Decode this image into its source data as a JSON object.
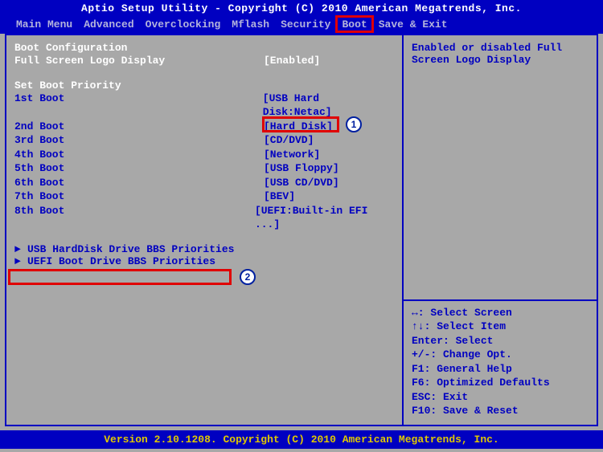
{
  "header": "Aptio Setup Utility - Copyright (C) 2010 American Megatrends, Inc.",
  "footer": "Version 2.10.1208. Copyright (C) 2010 American Megatrends, Inc.",
  "menu": {
    "items": [
      "Main Menu",
      "Advanced",
      "Overclocking",
      "Mflash",
      "Security",
      "Boot",
      "Save & Exit"
    ],
    "active_index": 5
  },
  "left": {
    "section1_title": "Boot Configuration",
    "logo_label": "Full Screen Logo Display",
    "logo_value": "[Enabled]",
    "section2_title": "Set Boot Priority",
    "boots": [
      {
        "label": "1st Boot",
        "value": "[USB Hard Disk:Netac]"
      },
      {
        "label": "2nd Boot",
        "value": "[Hard Disk]"
      },
      {
        "label": "3rd Boot",
        "value": "[CD/DVD]"
      },
      {
        "label": "4th Boot",
        "value": "[Network]"
      },
      {
        "label": "5th Boot",
        "value": "[USB Floppy]"
      },
      {
        "label": "6th Boot",
        "value": "[USB CD/DVD]"
      },
      {
        "label": "7th Boot",
        "value": "[BEV]"
      },
      {
        "label": "8th Boot",
        "value": "[UEFI:Built-in EFI ...]"
      }
    ],
    "submenus": [
      "USB HardDisk Drive BBS Priorities",
      "UEFI Boot Drive BBS Priorities"
    ]
  },
  "right": {
    "help_line1": "Enabled or disabled Full",
    "help_line2": "Screen Logo Display",
    "keys": [
      "↔: Select Screen",
      "↑↓: Select Item",
      "Enter: Select",
      "+/-: Change Opt.",
      "F1: General Help",
      "F6: Optimized Defaults",
      "ESC: Exit",
      "F10: Save & Reset"
    ]
  },
  "annotations": {
    "circle1": "1",
    "circle2": "2"
  }
}
